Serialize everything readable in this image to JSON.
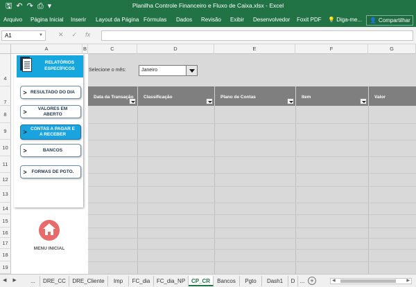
{
  "window": {
    "title": "Planilha Controle Financeiro e Fluxo de Caixa.xlsx - Excel",
    "accent": "#217346"
  },
  "qat": {
    "icons": [
      "save-icon",
      "undo-icon",
      "redo-icon",
      "print-preview-icon",
      "customize-icon"
    ]
  },
  "ribbon": {
    "tabs": [
      "Arquivo",
      "Página Inicial",
      "Inserir",
      "Layout da Página",
      "Fórmulas",
      "Dados",
      "Revisão",
      "Exibir",
      "Desenvolvedor",
      "Foxit PDF",
      "Diga-me..."
    ],
    "share_label": "Compartilhar"
  },
  "formula_bar": {
    "name_box": "A1",
    "cancel": "✕",
    "enter": "✓",
    "fx": "fx"
  },
  "columns": [
    "A",
    "B",
    "C",
    "D",
    "E",
    "F",
    "G"
  ],
  "rows": [
    "4",
    "7",
    "8",
    "9",
    "10",
    "11",
    "12",
    "13",
    "14",
    "15",
    "16",
    "17",
    "18",
    "19"
  ],
  "panel": {
    "title": "RELATÓRIOS ESPECÍFICOS",
    "buttons": [
      {
        "chev": ">",
        "label": "RESULTADO DO DIA"
      },
      {
        "chev": ">",
        "label": "VALORES EM ABERTO"
      },
      {
        "chev": ">",
        "label": "CONTAS A PAGAR E A RECEBER"
      },
      {
        "chev": ">",
        "label": "BANCOS"
      },
      {
        "chev": ">",
        "label": "FORMAS DE PGTO."
      }
    ],
    "home_label": "MENU INICIAL",
    "active_color": "#1aa3df"
  },
  "month_select": {
    "label": "Selecione o mês:",
    "value": "Janeiro"
  },
  "table": {
    "headers": [
      "Data da Transação",
      "Classificação",
      "Plano de Contas",
      "Item",
      "Valor"
    ]
  },
  "sheet_tabs": {
    "tabs": [
      "...",
      "DRE_CC",
      "DRE_Cliente",
      "Imp",
      "FC_dia",
      "FC_dia_NP",
      "CP_CR",
      "Bancos",
      "Pgto",
      "Dash1",
      "D"
    ],
    "active": "CP_CR",
    "more": "..."
  }
}
